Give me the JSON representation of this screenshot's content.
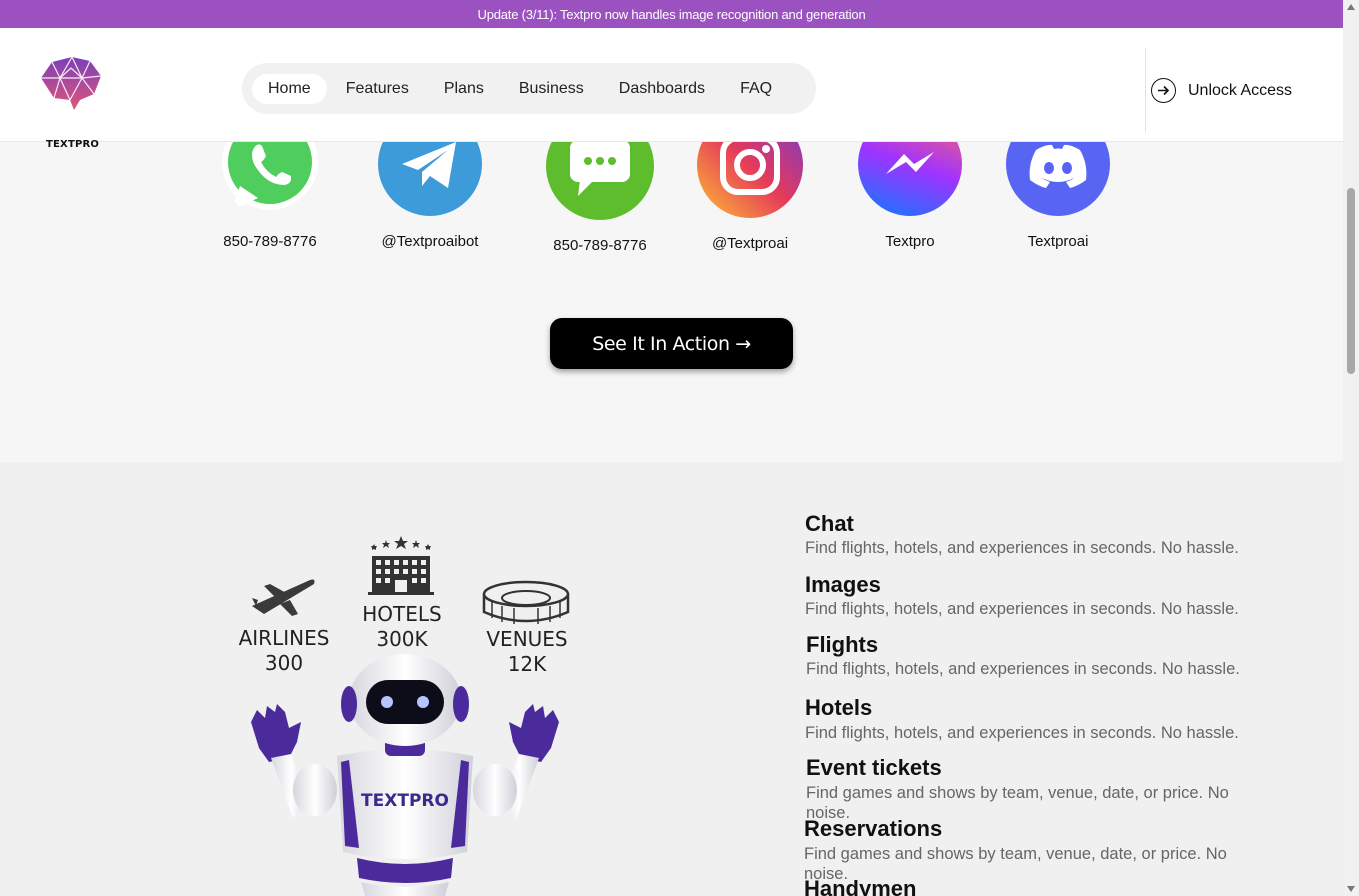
{
  "banner": {
    "text": "Update (3/11): Textpro now handles image recognition and generation"
  },
  "header": {
    "logo_text": "TEXTPRO",
    "nav": [
      {
        "label": "Home",
        "active": true
      },
      {
        "label": "Features"
      },
      {
        "label": "Plans"
      },
      {
        "label": "Business"
      },
      {
        "label": "Dashboards"
      },
      {
        "label": "FAQ"
      }
    ],
    "unlock_label": "Unlock Access"
  },
  "socials": [
    {
      "icon": "whatsapp-icon",
      "handle": "850-789-8776",
      "color": "#4fce5d"
    },
    {
      "icon": "telegram-icon",
      "handle": "@Textproaibot",
      "color": "#3d9bd9"
    },
    {
      "icon": "sms-icon",
      "handle": "850-789-8776",
      "color": "#5ebd2c"
    },
    {
      "icon": "instagram-icon",
      "handle": "@Textproai",
      "color": "#d62976"
    },
    {
      "icon": "messenger-icon",
      "handle": "Textpro",
      "color": "#7b4dff"
    },
    {
      "icon": "discord-icon",
      "handle": "Textproai",
      "color": "#5865f2"
    }
  ],
  "cta": {
    "label": "See It In Action →"
  },
  "stats": [
    {
      "label": "AIRLINES",
      "value": "300"
    },
    {
      "label": "HOTELS",
      "value": "300K"
    },
    {
      "label": "VENUES",
      "value": "12K"
    }
  ],
  "robot_text": "TEXTPRO",
  "features": [
    {
      "title": "Chat",
      "desc": "Find flights, hotels, and experiences in seconds. No hassle."
    },
    {
      "title": "Images",
      "desc": "Find flights, hotels, and experiences in seconds. No hassle."
    },
    {
      "title": "Flights",
      "desc": "Find flights, hotels, and experiences in seconds. No hassle."
    },
    {
      "title": "Hotels",
      "desc": "Find flights, hotels, and experiences in seconds. No hassle."
    },
    {
      "title": "Event tickets",
      "desc": "Find games and shows by team, venue, date, or price. No noise."
    },
    {
      "title": "Reservations",
      "desc": "Find games and shows by team, venue, date, or price. No noise."
    },
    {
      "title": "Handymen",
      "desc": ""
    }
  ],
  "colors": {
    "banner": "#9b51c0",
    "accent": "#5b2aa8"
  }
}
